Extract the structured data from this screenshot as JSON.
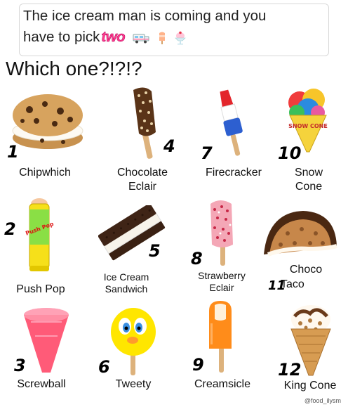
{
  "header": {
    "line1": "The ice cream man is coming and you",
    "line2_prefix": "have to pick",
    "highlight_word": "two",
    "emojis": [
      "ice-cream-truck-icon",
      "popsicle-icon",
      "sundae-icon"
    ]
  },
  "question": "Which one?!?!?",
  "items": [
    {
      "number": "1",
      "name": "Chipwhich"
    },
    {
      "number": "4",
      "name": "Chocolate Eclair",
      "line1": "Chocolate",
      "line2": "Eclair"
    },
    {
      "number": "7",
      "name": "Firecracker"
    },
    {
      "number": "10",
      "name": "Snow Cone",
      "line1": "Snow",
      "line2": "Cone"
    },
    {
      "number": "2",
      "name": "Push Pop"
    },
    {
      "number": "5",
      "name": "Ice Cream Sandwich",
      "line1": "Ice Cream",
      "line2": "Sandwich"
    },
    {
      "number": "8",
      "name": "Strawberry Eclair",
      "line1": "Strawberry",
      "line2": "Eclair"
    },
    {
      "number": "11",
      "name": "Choco Taco",
      "line1": "Choco",
      "line2": "Taco"
    },
    {
      "number": "3",
      "name": "Screwball"
    },
    {
      "number": "6",
      "name": "Tweety"
    },
    {
      "number": "9",
      "name": "Creamsicle"
    },
    {
      "number": "12",
      "name": "King Cone"
    }
  ],
  "snow_cone_cup_text": "SNOW CONE",
  "pushpop_wrapper_text": "Push Pop",
  "credit": "@food_ilysm"
}
